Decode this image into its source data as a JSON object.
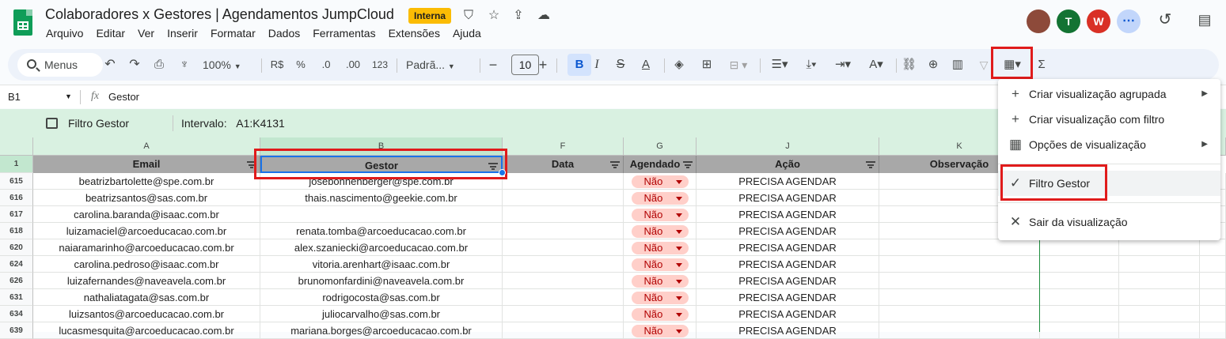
{
  "app": {
    "title": "Colaboradores x Gestores | Agendamentos JumpCloud",
    "badge": "Interna",
    "menus": [
      "Arquivo",
      "Editar",
      "Ver",
      "Inserir",
      "Formatar",
      "Dados",
      "Ferramentas",
      "Extensões",
      "Ajuda"
    ],
    "avatars": [
      {
        "letter": "",
        "color": "#8d4a3a"
      },
      {
        "letter": "T",
        "color": "#137333"
      },
      {
        "letter": "W",
        "color": "#d93025"
      }
    ]
  },
  "toolbar": {
    "search_label": "Menus",
    "zoom": "100%",
    "currency": "R$",
    "percent": "%",
    "dec_less": ".0",
    "dec_more": ".00",
    "number_format": "123",
    "font": "Padrã...",
    "font_size": "10",
    "bold": "B",
    "italic": "I",
    "strike": "S",
    "text_color": "A",
    "sigma": "Σ"
  },
  "formula_bar": {
    "cell_ref": "B1",
    "fx": "fx",
    "content": "Gestor"
  },
  "filter_bar": {
    "view_name": "Filtro Gestor",
    "range_label": "Intervalo:",
    "range": "A1:K4131"
  },
  "columns": [
    {
      "letter": "A",
      "header": "Email"
    },
    {
      "letter": "B",
      "header": "Gestor"
    },
    {
      "letter": "F",
      "header": "Data"
    },
    {
      "letter": "G",
      "header": "Agendado"
    },
    {
      "letter": "J",
      "header": "Ação"
    },
    {
      "letter": "K",
      "header": "Observação"
    }
  ],
  "header_row_number": "1",
  "rows": [
    {
      "num": "615",
      "email": "beatrizbartolette@spe.com.br",
      "gestor": "josebohnenberger@spe.com.br",
      "agendado": "Não",
      "acao": "PRECISA AGENDAR"
    },
    {
      "num": "616",
      "email": "beatrizsantos@sas.com.br",
      "gestor": "thais.nascimento@geekie.com.br",
      "agendado": "Não",
      "acao": "PRECISA AGENDAR"
    },
    {
      "num": "617",
      "email": "carolina.baranda@isaac.com.br",
      "gestor": "",
      "agendado": "Não",
      "acao": "PRECISA AGENDAR"
    },
    {
      "num": "618",
      "email": "luizamaciel@arcoeducacao.com.br",
      "gestor": "renata.tomba@arcoeducacao.com.br",
      "agendado": "Não",
      "acao": "PRECISA AGENDAR"
    },
    {
      "num": "620",
      "email": "naiaramarinho@arcoeducacao.com.br",
      "gestor": "alex.szaniecki@arcoeducacao.com.br",
      "agendado": "Não",
      "acao": "PRECISA AGENDAR"
    },
    {
      "num": "624",
      "email": "carolina.pedroso@isaac.com.br",
      "gestor": "vitoria.arenhart@isaac.com.br",
      "agendado": "Não",
      "acao": "PRECISA AGENDAR"
    },
    {
      "num": "626",
      "email": "luizafernandes@naveavela.com.br",
      "gestor": "brunomonfardini@naveavela.com.br",
      "agendado": "Não",
      "acao": "PRECISA AGENDAR"
    },
    {
      "num": "631",
      "email": "nathaliatagata@sas.com.br",
      "gestor": "rodrigocosta@sas.com.br",
      "agendado": "Não",
      "acao": "PRECISA AGENDAR"
    },
    {
      "num": "634",
      "email": "luizsantos@arcoeducacao.com.br",
      "gestor": "juliocarvalho@sas.com.br",
      "agendado": "Não",
      "acao": "PRECISA AGENDAR"
    },
    {
      "num": "639",
      "email": "lucasmesquita@arcoeducacao.com.br",
      "gestor": "mariana.borges@arcoeducacao.com.br",
      "agendado": "Não",
      "acao": "PRECISA AGENDAR"
    }
  ],
  "view_menu": {
    "items": [
      {
        "icon": "+",
        "label": "Criar visualização agrupada",
        "submenu": "▶"
      },
      {
        "icon": "+",
        "label": "Criar visualização com filtro",
        "submenu": ""
      },
      {
        "icon": "▦",
        "label": "Opções de visualização",
        "submenu": "▶"
      },
      {
        "icon": "✓",
        "label": "Filtro Gestor",
        "submenu": ""
      },
      {
        "icon": "✕",
        "label": "Sair da visualização",
        "submenu": ""
      }
    ]
  },
  "colors": {
    "highlight": "#e01b1b",
    "filter_bg": "#d9f1e1",
    "chip_bg": "#ffcfc9",
    "chip_text": "#b10202"
  }
}
